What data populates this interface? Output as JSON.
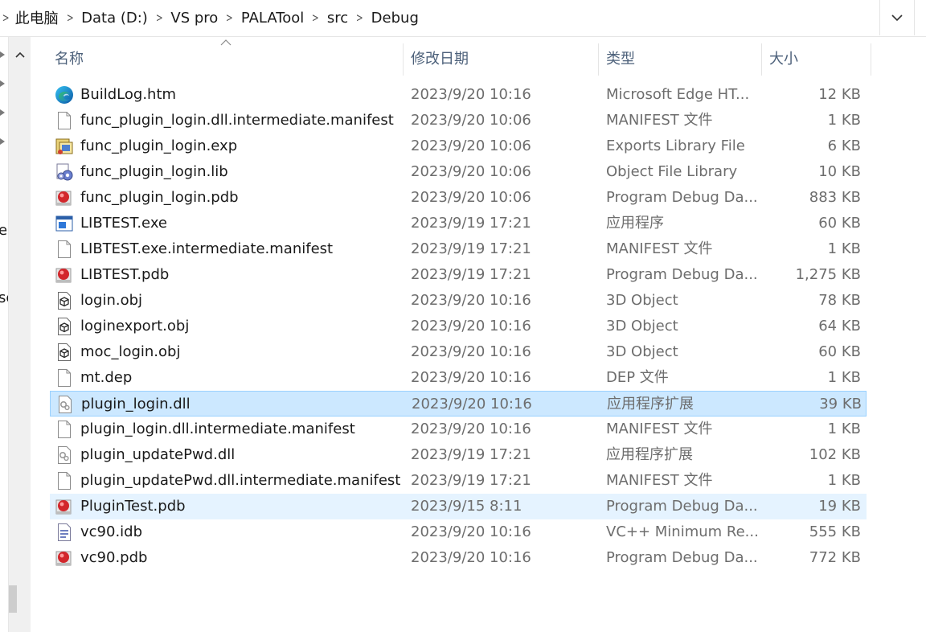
{
  "breadcrumb": {
    "items": [
      "此电脑",
      "Data (D:)",
      "VS pro",
      "PALATool",
      "src",
      "Debug"
    ]
  },
  "nav_fragments": [
    "eg",
    "sc"
  ],
  "columns": {
    "name": "名称",
    "date": "修改日期",
    "type": "类型",
    "size": "大小"
  },
  "files": [
    {
      "name": "BuildLog.htm",
      "date": "2023/9/20 10:16",
      "type": "Microsoft Edge HT...",
      "size": "12 KB",
      "icon": "edge-icon",
      "state": ""
    },
    {
      "name": "func_plugin_login.dll.intermediate.manifest",
      "date": "2023/9/20 10:06",
      "type": "MANIFEST 文件",
      "size": "1 KB",
      "icon": "blank-file-icon",
      "state": ""
    },
    {
      "name": "func_plugin_login.exp",
      "date": "2023/9/20 10:06",
      "type": "Exports Library File",
      "size": "6 KB",
      "icon": "exp-file-icon",
      "state": ""
    },
    {
      "name": "func_plugin_login.lib",
      "date": "2023/9/20 10:06",
      "type": "Object File Library",
      "size": "10 KB",
      "icon": "lib-file-icon",
      "state": ""
    },
    {
      "name": "func_plugin_login.pdb",
      "date": "2023/9/20 10:06",
      "type": "Program Debug Da...",
      "size": "883 KB",
      "icon": "pdb-file-icon",
      "state": ""
    },
    {
      "name": "LIBTEST.exe",
      "date": "2023/9/19 17:21",
      "type": "应用程序",
      "size": "60 KB",
      "icon": "exe-file-icon",
      "state": ""
    },
    {
      "name": "LIBTEST.exe.intermediate.manifest",
      "date": "2023/9/19 17:21",
      "type": "MANIFEST 文件",
      "size": "1 KB",
      "icon": "blank-file-icon",
      "state": ""
    },
    {
      "name": "LIBTEST.pdb",
      "date": "2023/9/19 17:21",
      "type": "Program Debug Da...",
      "size": "1,275 KB",
      "icon": "pdb-file-icon",
      "state": ""
    },
    {
      "name": "login.obj",
      "date": "2023/9/20 10:16",
      "type": "3D Object",
      "size": "78 KB",
      "icon": "3d-object-icon",
      "state": ""
    },
    {
      "name": "loginexport.obj",
      "date": "2023/9/20 10:16",
      "type": "3D Object",
      "size": "64 KB",
      "icon": "3d-object-icon",
      "state": ""
    },
    {
      "name": "moc_login.obj",
      "date": "2023/9/20 10:16",
      "type": "3D Object",
      "size": "60 KB",
      "icon": "3d-object-icon",
      "state": ""
    },
    {
      "name": "mt.dep",
      "date": "2023/9/20 10:16",
      "type": "DEP 文件",
      "size": "1 KB",
      "icon": "blank-file-icon",
      "state": ""
    },
    {
      "name": "plugin_login.dll",
      "date": "2023/9/20 10:16",
      "type": "应用程序扩展",
      "size": "39 KB",
      "icon": "dll-file-icon",
      "state": "selected"
    },
    {
      "name": "plugin_login.dll.intermediate.manifest",
      "date": "2023/9/20 10:16",
      "type": "MANIFEST 文件",
      "size": "1 KB",
      "icon": "blank-file-icon",
      "state": ""
    },
    {
      "name": "plugin_updatePwd.dll",
      "date": "2023/9/19 17:21",
      "type": "应用程序扩展",
      "size": "102 KB",
      "icon": "dll-file-icon",
      "state": ""
    },
    {
      "name": "plugin_updatePwd.dll.intermediate.manifest",
      "date": "2023/9/19 17:21",
      "type": "MANIFEST 文件",
      "size": "1 KB",
      "icon": "blank-file-icon",
      "state": ""
    },
    {
      "name": "PluginTest.pdb",
      "date": "2023/9/15 8:11",
      "type": "Program Debug Da...",
      "size": "19 KB",
      "icon": "pdb-file-icon",
      "state": "hover"
    },
    {
      "name": "vc90.idb",
      "date": "2023/9/20 10:16",
      "type": "VC++ Minimum Re...",
      "size": "555 KB",
      "icon": "idb-file-icon",
      "state": ""
    },
    {
      "name": "vc90.pdb",
      "date": "2023/9/20 10:16",
      "type": "Program Debug Da...",
      "size": "772 KB",
      "icon": "pdb-file-icon",
      "state": ""
    }
  ]
}
